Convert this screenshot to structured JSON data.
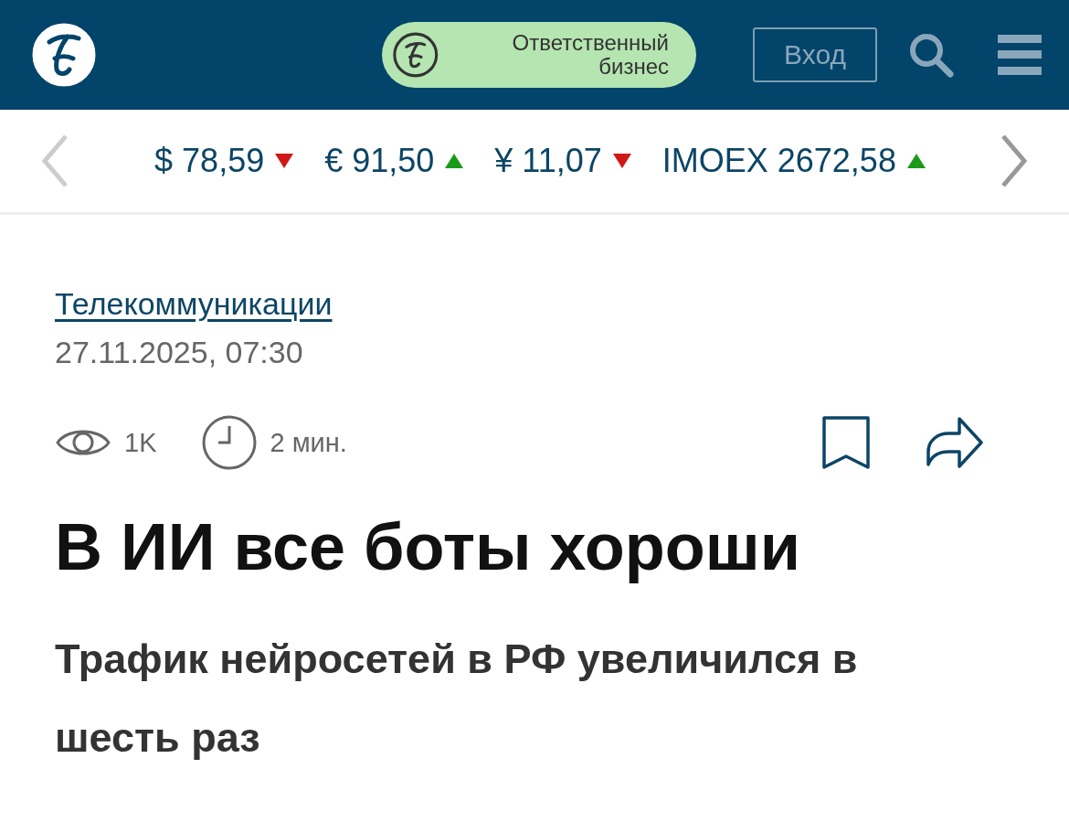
{
  "header": {
    "promo": {
      "label": "Ответственный бизнес"
    },
    "login_button": "Вход"
  },
  "ticker": [
    {
      "label": "$ 78,59",
      "rising": false
    },
    {
      "label": "€ 91,50",
      "rising": true
    },
    {
      "label": "¥ 11,07",
      "rising": false
    },
    {
      "label": "IMOEX 2672,58",
      "rising": true
    }
  ],
  "article": {
    "category": "Телекоммуникации",
    "date": "27.11.2025, 07:30",
    "views": "1K",
    "read_time": "2 мин.",
    "title": "В ИИ все боты хороши",
    "subtitle": "Трафик нейросетей в РФ увеличился в шесть раз"
  }
}
